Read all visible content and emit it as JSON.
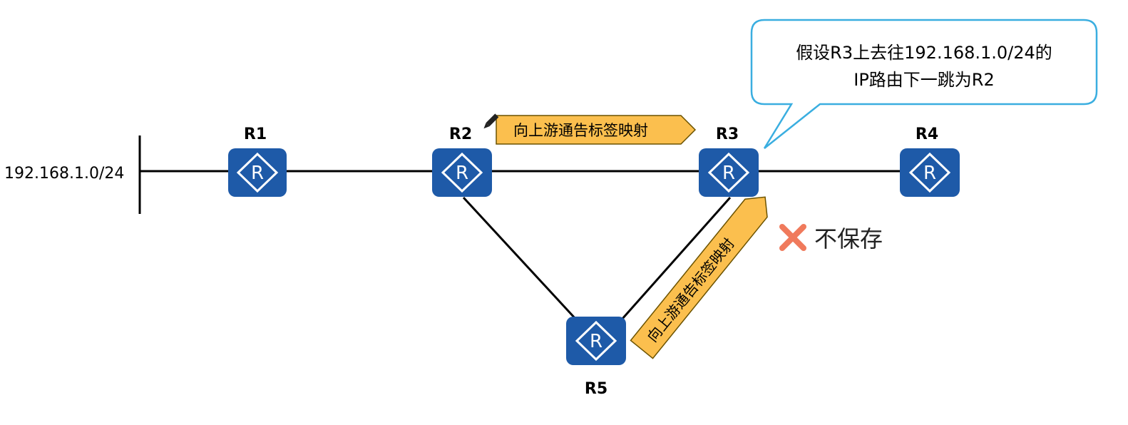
{
  "network": {
    "prefix_label": "192.168.1.0/24",
    "routers": [
      {
        "id": "r1",
        "label": "R1",
        "icon_letter": "R",
        "icon": "router-icon"
      },
      {
        "id": "r2",
        "label": "R2",
        "icon_letter": "R",
        "icon": "router-icon"
      },
      {
        "id": "r3",
        "label": "R3",
        "icon_letter": "R",
        "icon": "router-icon"
      },
      {
        "id": "r4",
        "label": "R4",
        "icon_letter": "R",
        "icon": "router-icon"
      },
      {
        "id": "r5",
        "label": "R5",
        "icon_letter": "R",
        "icon": "router-icon"
      }
    ]
  },
  "arrows": {
    "top_label": "向上游通告标签映射",
    "diag_label": "向上游通告标签映射"
  },
  "callout": {
    "line1": "假设R3上去往192.168.1.0/24的",
    "line2": "IP路由下一跳为R2"
  },
  "status": {
    "not_saved_label": "不保存",
    "icon": "cross-icon"
  },
  "colors": {
    "router_fill": "#1e5aa8",
    "arrow_fill": "#fbbf4e",
    "callout_border": "#3aaee0",
    "cross": "#f07a5c"
  }
}
